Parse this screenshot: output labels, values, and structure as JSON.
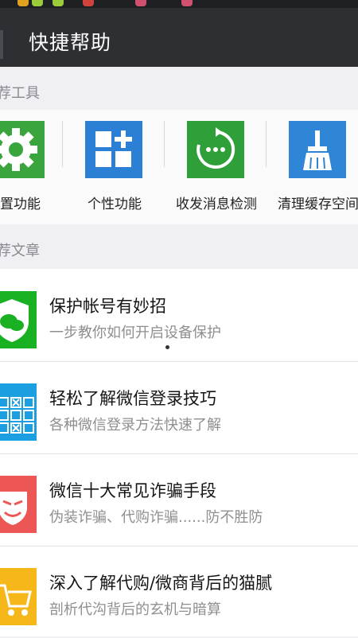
{
  "header": {
    "title": "快捷帮助"
  },
  "sections": {
    "tools_header": "荐工具",
    "articles_header": "荐文章"
  },
  "tools": [
    {
      "label": "置功能",
      "icon": "gear-icon",
      "color": "#3aa53c"
    },
    {
      "label": "个性功能",
      "icon": "grid-plus-icon",
      "color": "#2b7fd4"
    },
    {
      "label": "收发消息检测",
      "icon": "refresh-dots-icon",
      "color": "#2f9f3a"
    },
    {
      "label": "清理缓存空间",
      "icon": "broom-icon",
      "color": "#2f86d6"
    }
  ],
  "articles": [
    {
      "title": "保护帐号有妙招",
      "subtitle": "一步教你如何开启设备保护",
      "icon": "shield-wechat-icon",
      "color": "#19b021"
    },
    {
      "title": "轻松了解微信登录技巧",
      "subtitle": "各种微信登录方法快速了解",
      "icon": "pattern-grid-icon",
      "color": "#1b9fe0"
    },
    {
      "title": "微信十大常见诈骗手段",
      "subtitle": "伪装诈骗、代购诈骗......防不胜防",
      "icon": "mask-icon",
      "color": "#ec5755"
    },
    {
      "title": "深入了解代购/微商背后的猫腻",
      "subtitle": "剖析代沟背后的玄机与暗算",
      "icon": "cart-icon",
      "color": "#f5b71a"
    }
  ]
}
